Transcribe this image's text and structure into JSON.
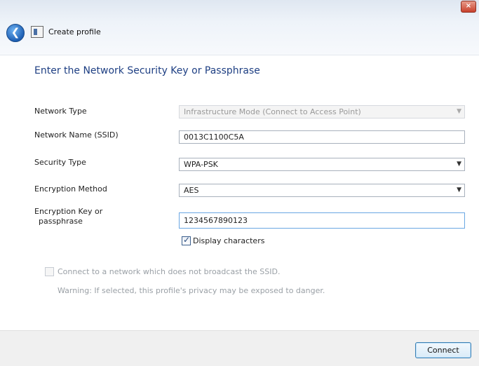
{
  "window": {
    "close_glyph": "×",
    "back_glyph": "❮",
    "title": "Create profile"
  },
  "heading": "Enter the Network Security Key or Passphrase",
  "form": {
    "network_type_label": "Network Type",
    "network_type_value": "Infrastructure Mode (Connect to Access Point)",
    "network_name_label": "Network Name (SSID)",
    "network_name_value": "0013C1100C5A",
    "security_type_label": "Security Type",
    "security_type_value": "WPA-PSK",
    "encryption_method_label": "Encryption Method",
    "encryption_method_value": "AES",
    "key_label_line1": "Encryption Key or",
    "key_label_line2": "passphrase",
    "key_value": "1234567890123",
    "show_chars_label": "Display characters",
    "show_chars_checked": true
  },
  "hidden_network": {
    "label": "Connect to a network which does not broadcast the SSID.",
    "warning": "Warning: If selected, this profile's privacy may be exposed to danger.",
    "checked": false
  },
  "footer": {
    "connect_label": "Connect"
  },
  "icons": {
    "back": "back-arrow-icon",
    "app": "profile-icon",
    "close": "close-icon",
    "dropdown": "chevron-down-icon"
  }
}
